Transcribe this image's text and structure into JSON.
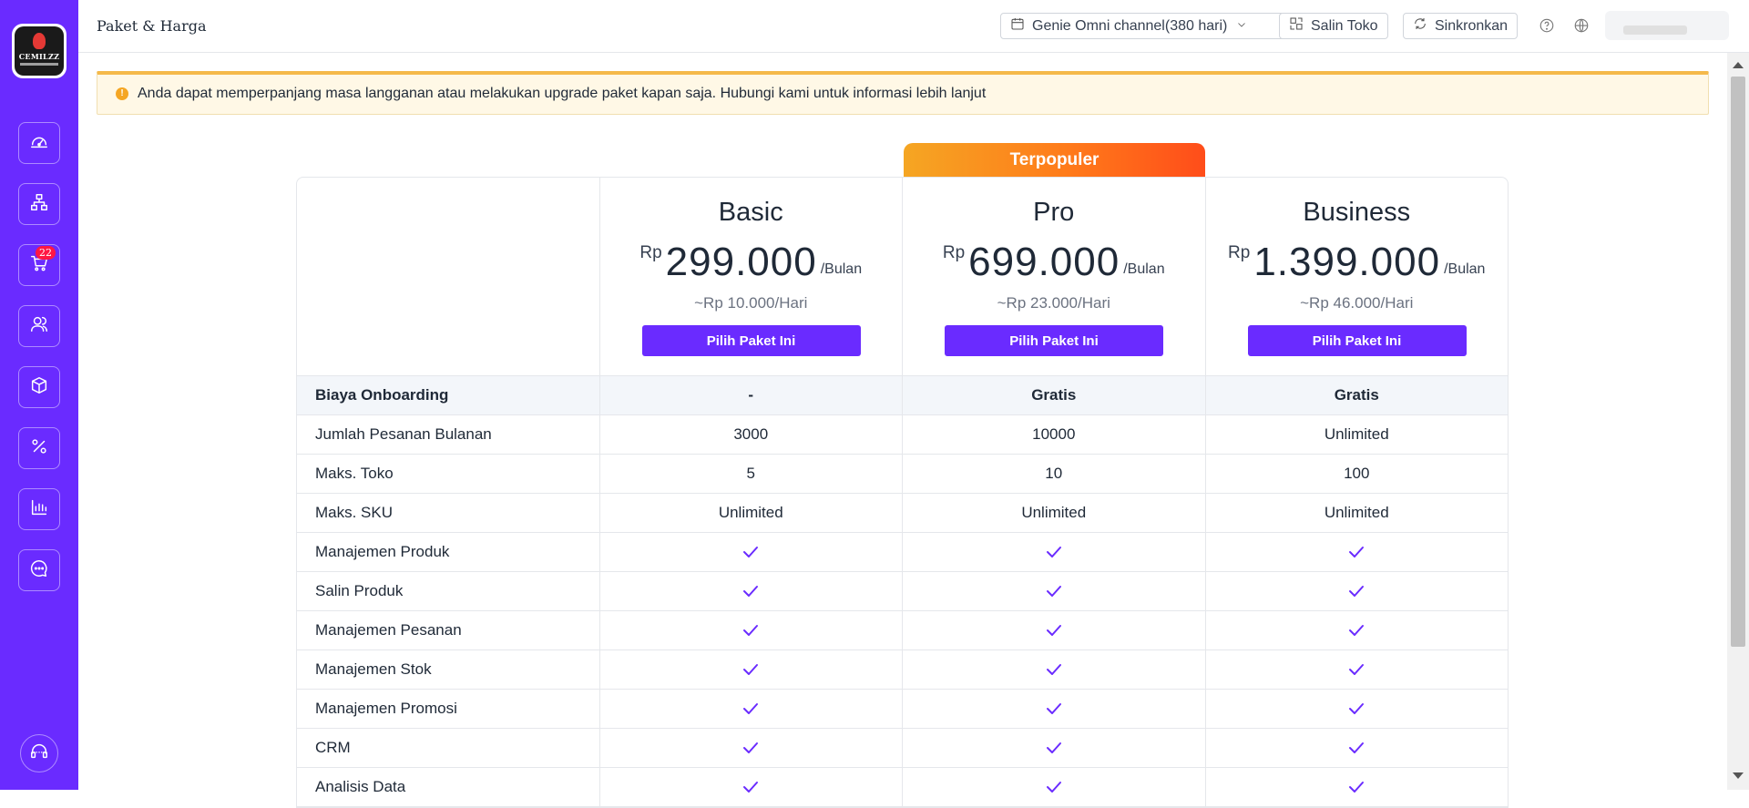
{
  "sidebar": {
    "logo_text": "CEMILZZ",
    "cart_badge": "22",
    "items": [
      {
        "icon": "dashboard-icon"
      },
      {
        "icon": "org-chart-icon"
      },
      {
        "icon": "cart-icon"
      },
      {
        "icon": "users-icon"
      },
      {
        "icon": "box-icon"
      },
      {
        "icon": "percent-icon"
      },
      {
        "icon": "bar-chart-icon"
      },
      {
        "icon": "chat-icon"
      }
    ],
    "support_icon": "headset-icon"
  },
  "header": {
    "title": "Paket & Harga",
    "store_selector": "Genie Omni channel(380 hari)",
    "copy_store": "Salin Toko",
    "sync": "Sinkronkan"
  },
  "notice": {
    "text": "Anda dapat memperpanjang masa langganan atau melakukan upgrade paket kapan saja. Hubungi kami untuk informasi lebih lanjut"
  },
  "pricing": {
    "popular_label": "Terpopuler",
    "plans": [
      {
        "name": "Basic",
        "currency": "Rp",
        "price": "299.000",
        "per": "/Bulan",
        "daily": "~Rp 10.000/Hari",
        "button": "Pilih Paket Ini"
      },
      {
        "name": "Pro",
        "currency": "Rp",
        "price": "699.000",
        "per": "/Bulan",
        "daily": "~Rp 23.000/Hari",
        "button": "Pilih Paket Ini"
      },
      {
        "name": "Business",
        "currency": "Rp",
        "price": "1.399.000",
        "per": "/Bulan",
        "daily": "~Rp 46.000/Hari",
        "button": "Pilih Paket Ini"
      }
    ],
    "rows": [
      {
        "feature": "Biaya Onboarding",
        "values": [
          "-",
          "Gratis",
          "Gratis"
        ],
        "header": true
      },
      {
        "feature": "Jumlah Pesanan Bulanan",
        "values": [
          "3000",
          "10000",
          "Unlimited"
        ]
      },
      {
        "feature": "Maks. Toko",
        "values": [
          "5",
          "10",
          "100"
        ]
      },
      {
        "feature": "Maks. SKU",
        "values": [
          "Unlimited",
          "Unlimited",
          "Unlimited"
        ]
      },
      {
        "feature": "Manajemen Produk",
        "values": [
          "check",
          "check",
          "check"
        ]
      },
      {
        "feature": "Salin Produk",
        "values": [
          "check",
          "check",
          "check"
        ]
      },
      {
        "feature": "Manajemen Pesanan",
        "values": [
          "check",
          "check",
          "check"
        ]
      },
      {
        "feature": "Manajemen Stok",
        "values": [
          "check",
          "check",
          "check"
        ]
      },
      {
        "feature": "Manajemen Promosi",
        "values": [
          "check",
          "check",
          "check"
        ]
      },
      {
        "feature": "CRM",
        "values": [
          "check",
          "check",
          "check"
        ]
      },
      {
        "feature": "Analisis Data",
        "values": [
          "check",
          "check",
          "check"
        ]
      }
    ]
  },
  "colors": {
    "primary": "#6a2bff",
    "popular_start": "#f5a623",
    "popular_end": "#ff4d1a",
    "notice_bg": "#fff8e6"
  }
}
